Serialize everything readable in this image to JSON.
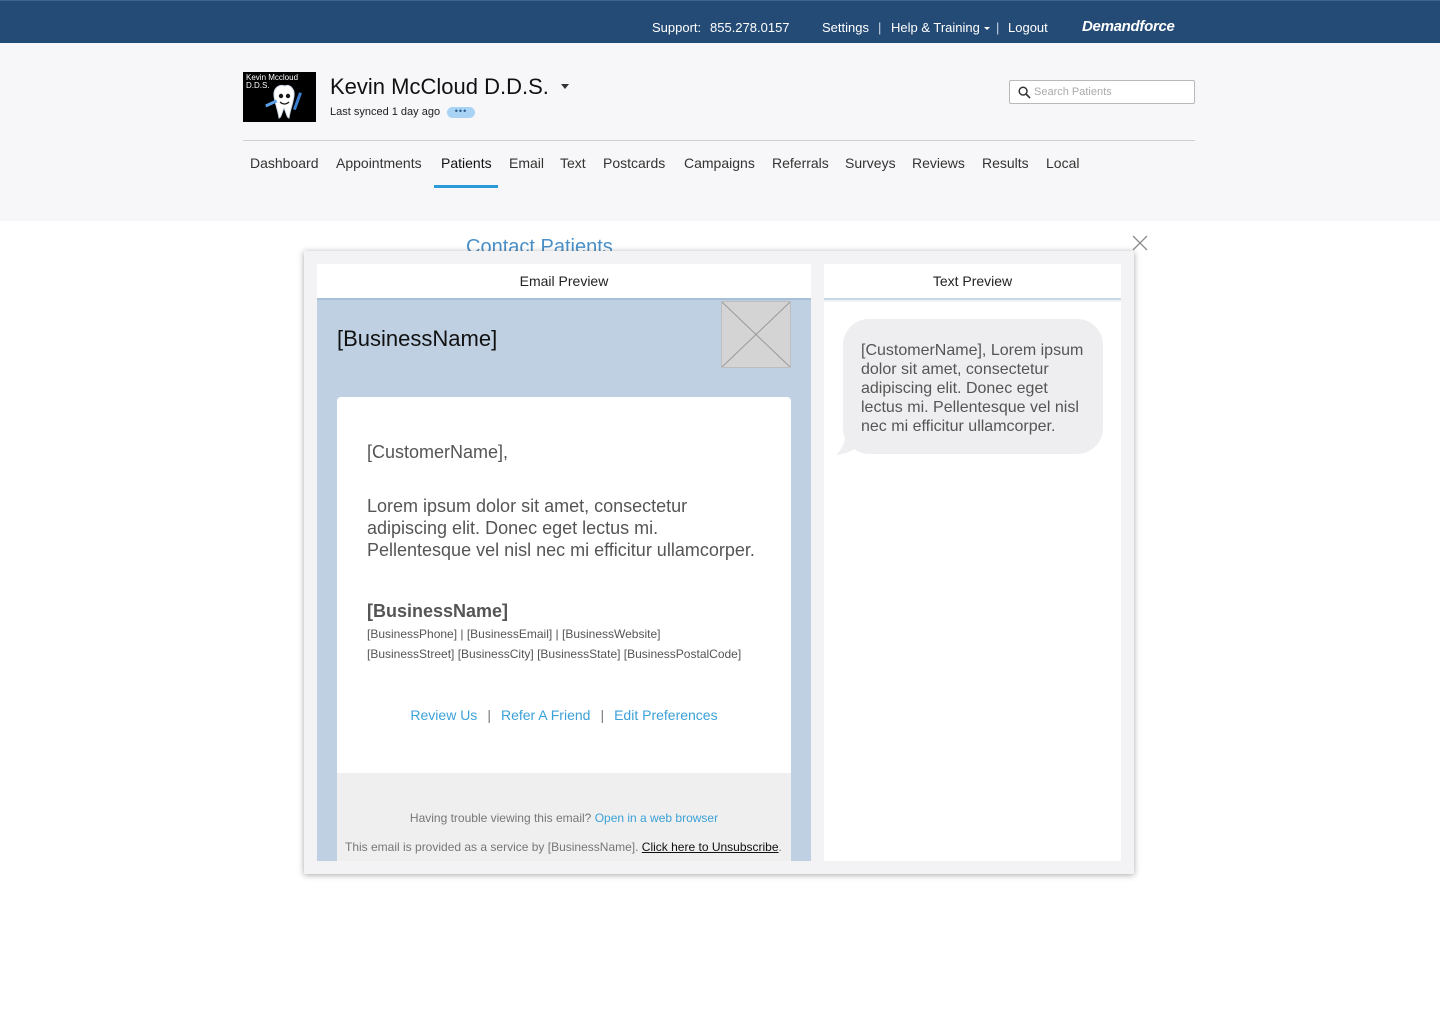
{
  "topbar": {
    "support_label": "Support:",
    "support_phone": "855.278.0157",
    "settings": "Settings",
    "sep": "|",
    "help": "Help & Training",
    "logout": "Logout",
    "brand": "Demandforce",
    "bg_color": "#244b75"
  },
  "header": {
    "avatar_text_1": "Kevin Mccloud",
    "avatar_text_2": "D.D.S.",
    "practice_name": "Kevin McCloud D.D.S.",
    "synced": "Last synced 1 day ago",
    "dots": "•••",
    "search_placeholder": "Search Patients"
  },
  "nav": {
    "items": [
      "Dashboard",
      "Appointments",
      "Patients",
      "Email",
      "Text",
      "Postcards",
      "Campaigns",
      "Referrals",
      "Surveys",
      "Reviews",
      "Results",
      "Local"
    ],
    "active": "Patients",
    "accent": "#2a9bd8"
  },
  "background": {
    "contact_title": "Contact Patients"
  },
  "email_preview": {
    "heading": "Email Preview",
    "business_name": "[BusinessName]",
    "greeting": "[CustomerName],",
    "body": "Lorem ipsum dolor sit amet, consectetur adipiscing elit. Donec eget lectus mi. Pellentesque vel nisl nec mi efficitur ullamcorper.",
    "signature_name": "[BusinessName]",
    "signature_line1": "[BusinessPhone] | [BusinessEmail] | [BusinessWebsite]",
    "signature_line2": "[BusinessStreet] [BusinessCity] [BusinessState] [BusinessPostalCode]",
    "links": [
      "Review Us",
      "Refer A Friend",
      "Edit Preferences"
    ],
    "link_sep": "|",
    "trouble_text": "Having trouble viewing this email?",
    "open_browser": "Open in a web browser",
    "service_text": "This email is provided as a service by [BusinessName].",
    "unsubscribe": "Click here to Unsubscribe",
    "period": ".",
    "link_color": "#3ba1d8"
  },
  "text_preview": {
    "heading": "Text Preview",
    "message": "[CustomerName], Lorem ipsum dolor sit amet, consectetur adipiscing elit. Donec eget lectus mi. Pellentesque vel nisl nec mi efficitur ullamcorper."
  }
}
